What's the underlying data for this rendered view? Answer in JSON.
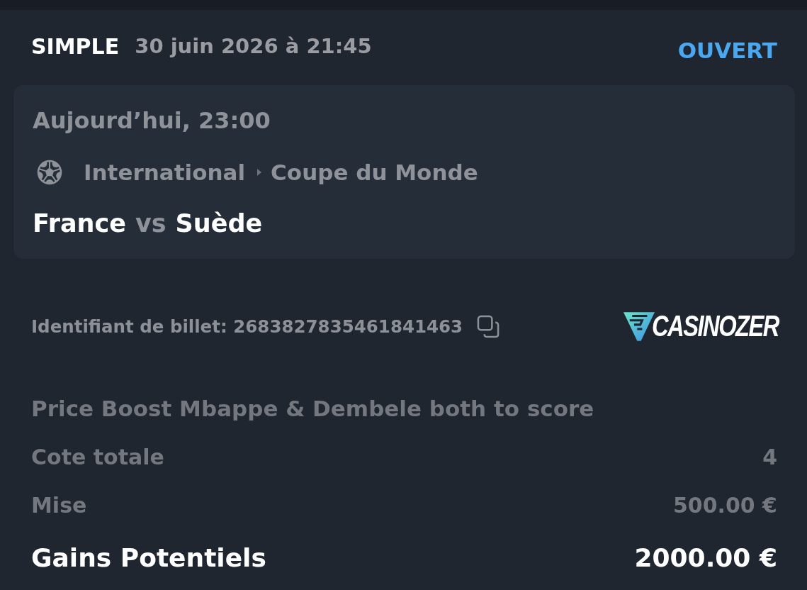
{
  "header": {
    "bet_type": "SIMPLE",
    "placed_at": "30 juin 2026 à 21:45",
    "status": "OUVERT"
  },
  "event": {
    "start_time": "Aujourd’hui, 23:00",
    "category": "International",
    "competition": "Coupe du Monde",
    "home_team": "France",
    "separator": "vs",
    "away_team": "Suède"
  },
  "ticket": {
    "id_text": "Identifiant de billet: 2683827835461841463"
  },
  "brand": {
    "name": "CASINOZER"
  },
  "selection": "Price Boost Mbappe & Dembele both to score",
  "summary": [
    {
      "kind": "normal",
      "label": "Cote totale",
      "value": "4"
    },
    {
      "kind": "normal",
      "label": "Mise",
      "value": "500.00 €"
    },
    {
      "kind": "total",
      "label": "Gains Potentiels",
      "value": "2000.00 €"
    }
  ]
}
